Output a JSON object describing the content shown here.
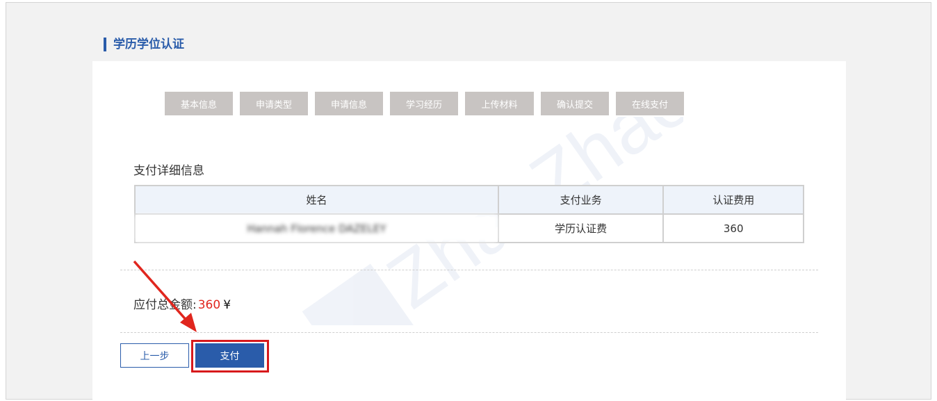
{
  "page": {
    "title": "学历学位认证"
  },
  "steps": [
    "基本信息",
    "申请类型",
    "申请信息",
    "学习经历",
    "上传材料",
    "确认提交",
    "在线支付"
  ],
  "detail": {
    "title": "支付详细信息",
    "headers": [
      "姓名",
      "支付业务",
      "认证费用"
    ],
    "row": {
      "name": "Hannah Florence DAZELEY",
      "service": "学历认证费",
      "fee": "360"
    }
  },
  "total": {
    "label": "应付总金额:",
    "amount": "360",
    "currency": "¥"
  },
  "buttons": {
    "prev": "上一步",
    "pay": "支付"
  },
  "watermark": {
    "text": "ZhaoZhao"
  },
  "colors": {
    "accent": "#2a5caa",
    "step_bg": "#c8c4c2",
    "amount": "#e0261e",
    "highlight": "#d7191c"
  }
}
